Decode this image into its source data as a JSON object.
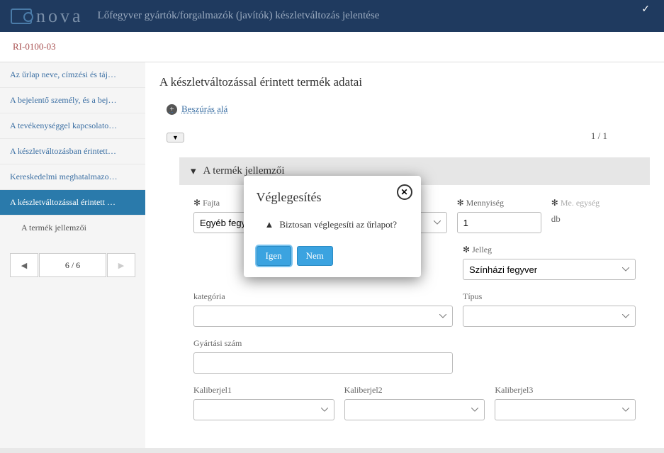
{
  "header": {
    "brand": "nova",
    "title": "Lőfegyver gyártók/forgalmazók (javítók) készletváltozás jelentése"
  },
  "breadcrumb": "RI-0100-03",
  "sidebar": {
    "items": [
      {
        "label": "Az űrlap neve, címzési és táj…"
      },
      {
        "label": "A bejelentő személy, és a bej…"
      },
      {
        "label": "A tevékenységgel kapcsolato…"
      },
      {
        "label": "A készletváltozásban érintett…"
      },
      {
        "label": "Kereskedelmi meghatalmazo…"
      },
      {
        "label": "A készletváltozással érintett …"
      }
    ],
    "subitem": "A termék jellemzői",
    "pager": {
      "center": "6 / 6"
    }
  },
  "main": {
    "title": "A készletváltozással érintett termék adatai",
    "insert": "Beszúrás alá",
    "counter": "1 / 1",
    "section": {
      "header": "A termék jellemzői",
      "fields": {
        "fajta": {
          "label": "Fajta",
          "value": "Egyéb fegyver"
        },
        "mennyiseg": {
          "label": "Mennyiség",
          "value": "1"
        },
        "me": {
          "label": "Me. egység",
          "value": "db"
        },
        "jelleg": {
          "label": "Jelleg",
          "value": "Színházi fegyver"
        },
        "kategoria": {
          "label": "kategória",
          "value": ""
        },
        "tipus": {
          "label": "Típus",
          "value": ""
        },
        "gyszam": {
          "label": "Gyártási szám",
          "value": ""
        },
        "kal1": {
          "label": "Kaliberjel1",
          "value": ""
        },
        "kal2": {
          "label": "Kaliberjel2",
          "value": ""
        },
        "kal3": {
          "label": "Kaliberjel3",
          "value": ""
        }
      }
    }
  },
  "modal": {
    "title": "Véglegesítés",
    "message": "Biztosan véglegesíti az űrlapot?",
    "yes": "Igen",
    "no": "Nem"
  }
}
